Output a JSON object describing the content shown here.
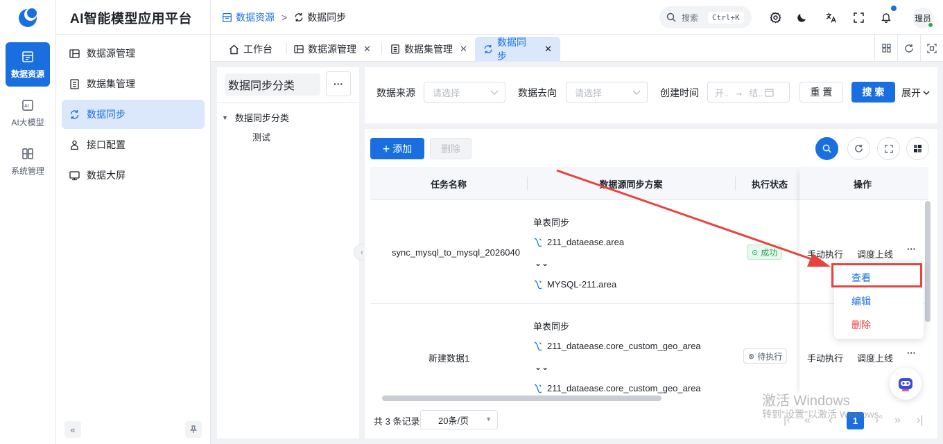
{
  "app": {
    "title": "AI智能模型应用平台"
  },
  "rail": [
    {
      "label": "数据资源",
      "icon": "data-resource-icon",
      "active": true
    },
    {
      "label": "AI大模型",
      "icon": "ai-model-icon",
      "active": false
    },
    {
      "label": "系统管理",
      "icon": "system-manage-icon",
      "active": false
    }
  ],
  "menu": [
    {
      "label": "数据源管理",
      "icon": "datasource-icon"
    },
    {
      "label": "数据集管理",
      "icon": "dataset-icon"
    },
    {
      "label": "数据同步",
      "icon": "sync-icon",
      "active": true
    },
    {
      "label": "接口配置",
      "icon": "api-config-icon"
    },
    {
      "label": "数据大屏",
      "icon": "monitor-icon"
    }
  ],
  "breadcrumb": {
    "parent": "数据资源",
    "sep": ">",
    "current": "数据同步"
  },
  "header": {
    "search_placeholder": "搜索",
    "shortcut": "Ctrl+K",
    "user": "理员"
  },
  "tabs": [
    {
      "label": "工作台",
      "icon": "home-icon",
      "closable": false
    },
    {
      "label": "数据源管理",
      "icon": "datasource-icon",
      "closable": true
    },
    {
      "label": "数据集管理",
      "icon": "dataset-icon",
      "closable": true
    },
    {
      "label": "数据同步",
      "icon": "sync-icon",
      "closable": true,
      "active": true
    }
  ],
  "tree": {
    "title": "数据同步分类",
    "more": "···",
    "root": "数据同步分类",
    "child": "测试"
  },
  "filters": {
    "source_label": "数据来源",
    "source_placeholder": "请选择",
    "target_label": "数据去向",
    "target_placeholder": "请选择",
    "time_label": "创建时间",
    "start_placeholder": "开..",
    "arrow": "→",
    "end_placeholder": "结..",
    "reset": "重 置",
    "search": "搜 索",
    "expand": "展开"
  },
  "toolbar": {
    "add": "添加",
    "delete": "删除"
  },
  "table": {
    "columns": [
      "任务名称",
      "数据源同步方案",
      "执行状态",
      "操作"
    ],
    "rows": [
      {
        "name": "sync_mysql_to_mysql_2026040",
        "plan_title": "单表同步",
        "source": "211_dataease.area",
        "target": "MYSQL-211.area",
        "status": "成功",
        "status_type": "success",
        "action1": "手动执行",
        "action2": "调度上线",
        "more": "···"
      },
      {
        "name": "新建数据1",
        "plan_title": "单表同步",
        "source": "211_dataease.core_custom_geo_area",
        "target": "211_dataease.core_custom_geo_area",
        "status": "待执行",
        "status_type": "pending",
        "action1": "手动执行",
        "action2": "调度上线",
        "more": "···"
      }
    ]
  },
  "dropdown": {
    "view": "查看",
    "edit": "编辑",
    "delete": "删除"
  },
  "pager": {
    "total": "共 3 条记录",
    "size": "20条/页",
    "current": "1"
  },
  "watermark": {
    "line1": "激活 Windows",
    "line2": "转到\"设置\"以激活 Windows。"
  },
  "colors": {
    "primary": "#1a6fe0",
    "danger": "#e8433f",
    "success": "#2aa55a"
  }
}
